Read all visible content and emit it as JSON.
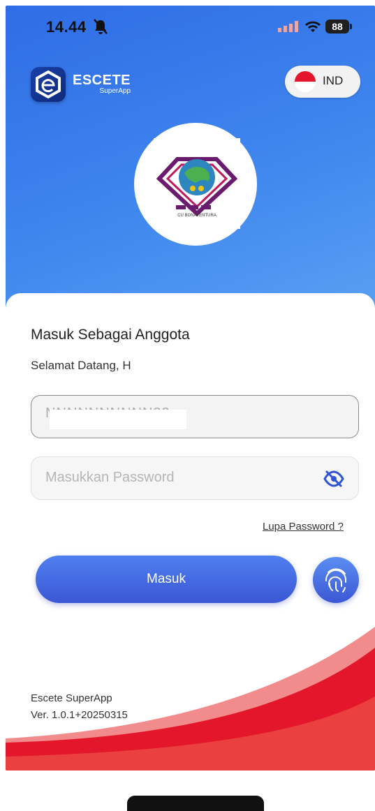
{
  "status_bar": {
    "time": "14.44",
    "battery": "88"
  },
  "header": {
    "brand_name": "ESCETE",
    "brand_sub": "SuperApp",
    "language": "IND"
  },
  "login": {
    "title": "Masuk Sebagai Anggota",
    "welcome": "Selamat Datang, H",
    "username_value": "NNNNNNNNNN33",
    "password_placeholder": "Masukkan Password",
    "forgot_label": "Lupa Password ?",
    "submit_label": "Masuk"
  },
  "org_logo_text": "CU BONAVENTURA",
  "footer": {
    "app_name": "Escete SuperApp",
    "version": "Ver. 1.0.1+20250315"
  },
  "colors": {
    "primary": "#3b57d4",
    "hero": "#3f86ee",
    "accent_red": "#e3162b"
  },
  "icons": [
    "bell-muted-icon",
    "signal-icon",
    "wifi-icon",
    "battery-icon",
    "app-logo-icon",
    "indonesia-flag-icon",
    "eye-off-icon",
    "fingerprint-icon"
  ]
}
